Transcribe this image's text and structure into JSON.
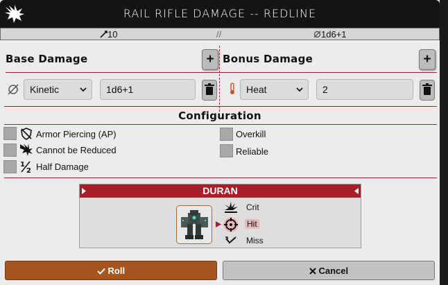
{
  "window": {
    "title": "RAIL RIFLE DAMAGE -- REDLINE"
  },
  "statbar": {
    "attack_value": "10",
    "separator": "//",
    "damage_value": "1d6+1"
  },
  "base_damage": {
    "heading": "Base Damage",
    "add_label": "+",
    "rows": [
      {
        "type_icon": "kinetic-icon",
        "type": "Kinetic",
        "value": "1d6+1"
      }
    ]
  },
  "bonus_damage": {
    "heading": "Bonus Damage",
    "add_label": "+",
    "rows": [
      {
        "type_icon": "heat-icon",
        "type": "Heat",
        "value": "2"
      }
    ]
  },
  "configuration": {
    "heading": "Configuration",
    "options": [
      {
        "label": "Armor Piercing (AP)",
        "icon": "armor-piercing-icon",
        "checked": false
      },
      {
        "label": "Cannot be Reduced",
        "icon": "cannot-be-reduced-icon",
        "checked": false
      },
      {
        "label": "Half Damage",
        "icon": "half-damage-icon",
        "checked": false
      },
      {
        "label": "Overkill",
        "checked": false
      },
      {
        "label": "Reliable",
        "checked": false
      }
    ]
  },
  "target": {
    "name": "DURAN",
    "results": [
      {
        "label": "Crit",
        "icon": "crit-icon",
        "selected": false
      },
      {
        "label": "Hit",
        "icon": "hit-icon",
        "selected": true
      },
      {
        "label": "Miss",
        "icon": "miss-icon",
        "selected": false
      }
    ]
  },
  "buttons": {
    "roll": "Roll",
    "cancel": "Cancel"
  },
  "colors": {
    "accent": "#a81e2a",
    "roll": "#a4561e",
    "heat": "#c8502a"
  }
}
